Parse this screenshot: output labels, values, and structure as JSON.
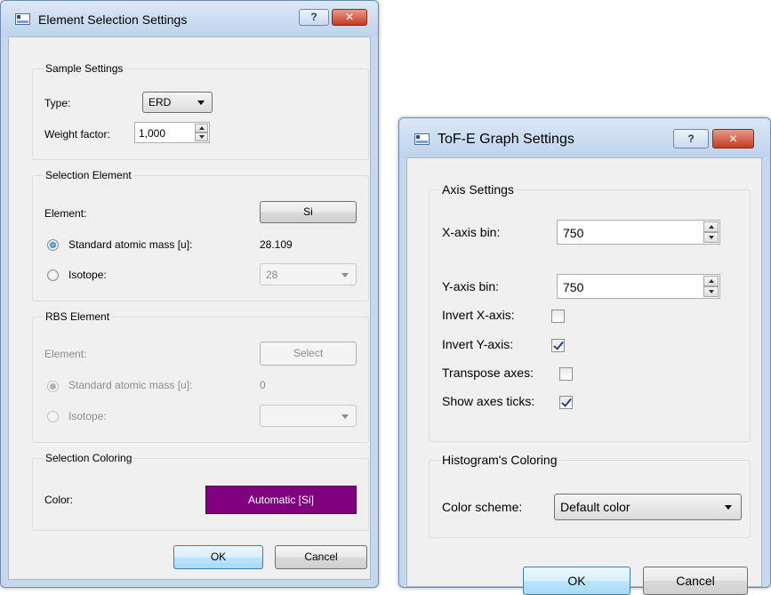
{
  "element_dialog": {
    "title": "Element Selection Settings",
    "help_label": "?",
    "close_label": "✕",
    "sample": {
      "legend": "Sample Settings",
      "type_label": "Type:",
      "type_value": "ERD",
      "weight_label": "Weight factor:",
      "weight_value": "1,000"
    },
    "selection_element": {
      "legend": "Selection Element",
      "element_label": "Element:",
      "element_button": "Si",
      "standard_mass_label": "Standard atomic mass [u]:",
      "standard_mass_value": "28.109",
      "isotope_label": "Isotope:",
      "isotope_value": "28"
    },
    "rbs_element": {
      "legend": "RBS Element",
      "element_label": "Element:",
      "element_button": "Select",
      "standard_mass_label": "Standard atomic mass [u]:",
      "standard_mass_value": "0",
      "isotope_label": "Isotope:",
      "isotope_value": ""
    },
    "coloring": {
      "legend": "Selection Coloring",
      "color_label": "Color:",
      "color_button": "Automatic [Si]",
      "color_value": "#800080"
    },
    "ok_label": "OK",
    "cancel_label": "Cancel"
  },
  "tofe_dialog": {
    "title": "ToF-E Graph Settings",
    "help_label": "?",
    "close_label": "✕",
    "axis": {
      "legend": "Axis Settings",
      "x_bin_label": "X-axis bin:",
      "x_bin_value": "750",
      "y_bin_label": "Y-axis bin:",
      "y_bin_value": "750",
      "invert_x_label": "Invert X-axis:",
      "invert_x_checked": false,
      "invert_y_label": "Invert Y-axis:",
      "invert_y_checked": true,
      "transpose_label": "Transpose axes:",
      "transpose_checked": false,
      "ticks_label": "Show axes ticks:",
      "ticks_checked": true
    },
    "histogram": {
      "legend": "Histogram's Coloring",
      "scheme_label": "Color scheme:",
      "scheme_value": "Default color"
    },
    "ok_label": "OK",
    "cancel_label": "Cancel"
  },
  "colors": {
    "title_bar": "#bed3ec",
    "client_bg": "#f0f0f0",
    "close_button": "#c33c22",
    "selection_color": "#800080"
  }
}
